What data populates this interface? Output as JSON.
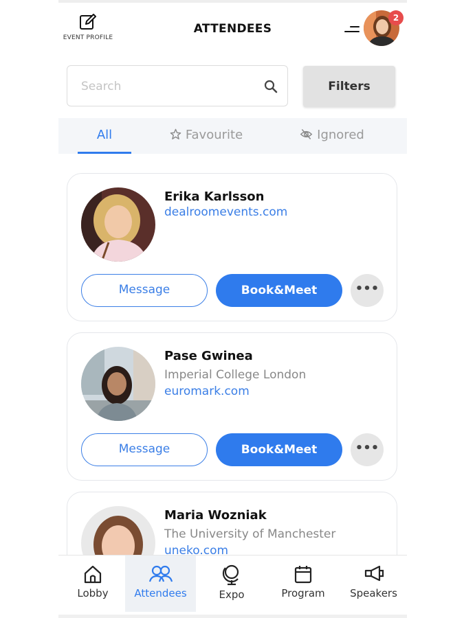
{
  "header": {
    "event_profile_label": "EVENT PROFILE",
    "title": "ATTENDEES",
    "notification_count": "2"
  },
  "search": {
    "placeholder": "Search",
    "value": ""
  },
  "filters_label": "Filters",
  "tabs": [
    {
      "label": "All",
      "icon": "none",
      "active": true
    },
    {
      "label": "Favourite",
      "icon": "star-icon",
      "active": false
    },
    {
      "label": "Ignored",
      "icon": "eye-slash-icon",
      "active": false
    }
  ],
  "attendees": [
    {
      "name": "Erika Karlsson",
      "organization": "",
      "website": "dealroomevents.com"
    },
    {
      "name": "Pase Gwinea",
      "organization": "Imperial College London",
      "website": "euromark.com"
    },
    {
      "name": "Maria Wozniak",
      "organization": "The University of Manchester",
      "website": "uneko.com"
    }
  ],
  "card_actions": {
    "message_label": "Message",
    "book_label": "Book&Meet",
    "more_label": "•••"
  },
  "bottom_nav": [
    {
      "label": "Lobby",
      "icon": "home-icon",
      "active": false
    },
    {
      "label": "Attendees",
      "icon": "people-icon",
      "active": true
    },
    {
      "label": "Expo",
      "icon": "globe-icon",
      "active": false
    },
    {
      "label": "Program",
      "icon": "calendar-icon",
      "active": false
    },
    {
      "label": "Speakers",
      "icon": "megaphone-icon",
      "active": false
    }
  ],
  "colors": {
    "accent": "#2f7bed",
    "link": "#3a7ee6",
    "badge": "#e74c4c",
    "tab_bar_bg": "#f4f6f9"
  }
}
